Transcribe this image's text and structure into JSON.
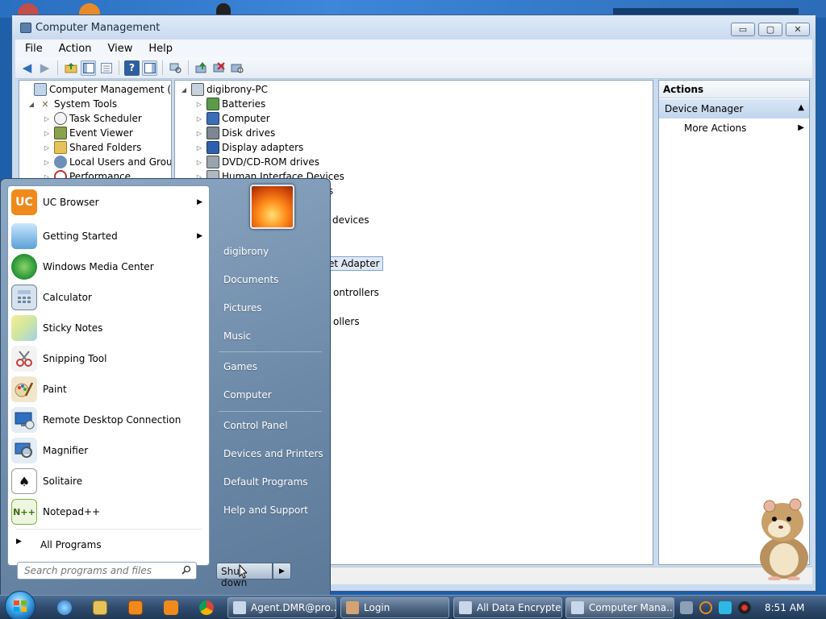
{
  "window": {
    "title": "Computer Management",
    "minimize_label": "▭",
    "maximize_label": "▢",
    "close_label": "✕"
  },
  "menu": [
    "File",
    "Action",
    "View",
    "Help"
  ],
  "left_tree": [
    {
      "label": "Computer Management (Local",
      "icon": "computer-management-icon",
      "expander": ""
    },
    {
      "label": "System Tools",
      "icon": "tools-icon",
      "expander": "◢"
    },
    {
      "label": "Task Scheduler",
      "icon": "clock-icon",
      "expander": "▷"
    },
    {
      "label": "Event Viewer",
      "icon": "event-viewer-icon",
      "expander": "▷"
    },
    {
      "label": "Shared Folders",
      "icon": "shared-folder-icon",
      "expander": "▷"
    },
    {
      "label": "Local Users and Groups",
      "icon": "users-icon",
      "expander": "▷"
    },
    {
      "label": "Performance",
      "icon": "performance-icon",
      "expander": "▷"
    }
  ],
  "device_tree": [
    {
      "label": "digibrony-PC",
      "icon": "computer-icon",
      "expander": "◢"
    },
    {
      "label": "Batteries",
      "icon": "battery-icon",
      "expander": "▷"
    },
    {
      "label": "Computer",
      "icon": "computer-icon",
      "expander": "▷"
    },
    {
      "label": "Disk drives",
      "icon": "disk-icon",
      "expander": "▷"
    },
    {
      "label": "Display adapters",
      "icon": "display-icon",
      "expander": "▷"
    },
    {
      "label": "DVD/CD-ROM drives",
      "icon": "dvd-icon",
      "expander": "▷"
    },
    {
      "label": "Human Interface Devices",
      "icon": "hid-icon",
      "expander": "▷"
    }
  ],
  "device_tree_partial": [
    {
      "label": "rs"
    },
    {
      "label": "devices"
    },
    {
      "label": "et Adapter"
    },
    {
      "label": "ontrollers"
    },
    {
      "label": "ollers"
    }
  ],
  "actions": {
    "header": "Actions",
    "section": "Device Manager",
    "section_arrow": "▲",
    "more": "More Actions",
    "more_arrow": "▶"
  },
  "start_menu": {
    "programs": [
      {
        "label": "UC Browser",
        "icon": "uc-browser-icon",
        "color": "#f08a1c",
        "arrow": "▶"
      },
      {
        "label": "Getting Started",
        "icon": "getting-started-icon",
        "color": "#5aa0d8",
        "arrow": "▶"
      },
      {
        "label": "Windows Media Center",
        "icon": "media-center-icon",
        "color": "#2e9a3a",
        "arrow": ""
      },
      {
        "label": "Calculator",
        "icon": "calculator-icon",
        "color": "#7e95ad",
        "arrow": ""
      },
      {
        "label": "Sticky Notes",
        "icon": "sticky-notes-icon",
        "color": "#e9e28c",
        "arrow": ""
      },
      {
        "label": "Snipping Tool",
        "icon": "scissors-icon",
        "color": "#c43c3c",
        "arrow": ""
      },
      {
        "label": "Paint",
        "icon": "paint-icon",
        "color": "#d29a3a",
        "arrow": ""
      },
      {
        "label": "Remote Desktop Connection",
        "icon": "remote-desktop-icon",
        "color": "#2f6fc0",
        "arrow": ""
      },
      {
        "label": "Magnifier",
        "icon": "magnifier-icon",
        "color": "#3a7bc8",
        "arrow": ""
      },
      {
        "label": "Solitaire",
        "icon": "solitaire-icon",
        "color": "#e9e9e9",
        "arrow": ""
      },
      {
        "label": "Notepad++",
        "icon": "notepad-plus-icon",
        "color": "#7ab53a",
        "arrow": ""
      }
    ],
    "all_programs": "All Programs",
    "all_programs_arrow": "▶",
    "search_placeholder": "Search programs and files",
    "right_items": [
      "digibrony",
      "Documents",
      "Pictures",
      "Music",
      "Games",
      "Computer",
      "Control Panel",
      "Devices and Printers",
      "Default Programs",
      "Help and Support"
    ],
    "shutdown_label": "Shut down",
    "shutdown_arrow": "▶"
  },
  "taskbar": {
    "tasks": [
      {
        "label": "Agent.DMR@pro...",
        "icon": "agent-icon",
        "color": "#c9d7ea"
      },
      {
        "label": "Login",
        "icon": "login-icon",
        "color": "#d4a373"
      },
      {
        "label": "All Data Encrypted",
        "icon": "window-icon",
        "color": "#c9d7ea"
      },
      {
        "label": "Computer Mana...",
        "icon": "computer-management-icon",
        "color": "#c9d7ea"
      }
    ],
    "clock": "8:51 AM"
  }
}
